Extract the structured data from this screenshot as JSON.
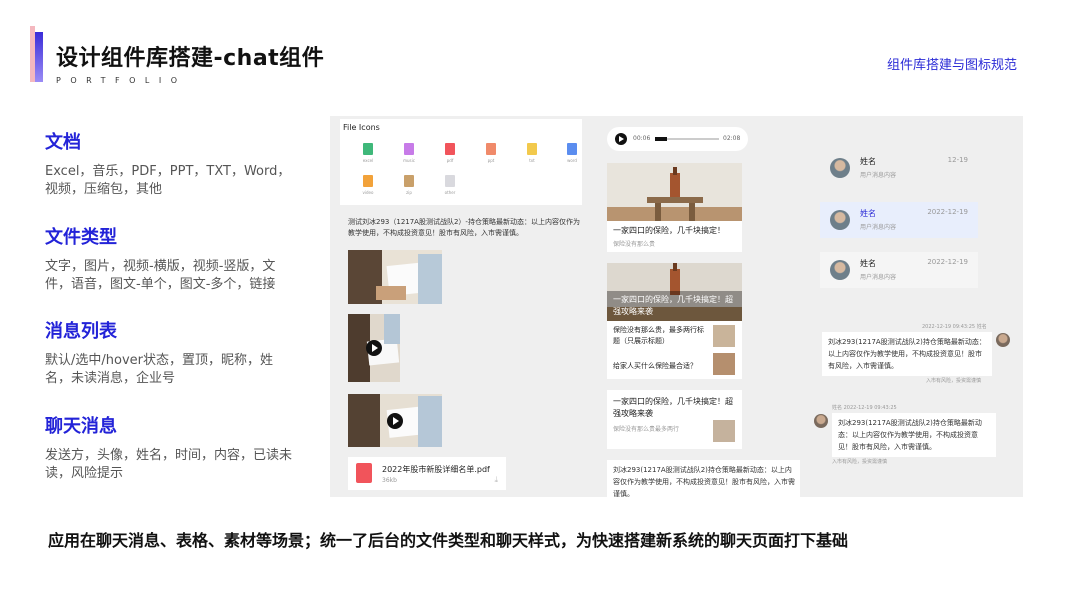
{
  "header": {
    "title": "设计组件库搭建-chat组件",
    "subtitle": "PORTFOLIO",
    "top_link": "组件库搭建与图标规范"
  },
  "sections": [
    {
      "heading": "文档",
      "body": "Excel，音乐，PDF，PPT，TXT，Word，视频，压缩包，其他"
    },
    {
      "heading": "文件类型",
      "body": "文字，图片，视频-横版，视频-竖版，文件，语音，图文-单个，图文-多个，链接"
    },
    {
      "heading": "消息列表",
      "body": "默认/选中/hover状态，置顶，昵称，姓名，未读消息，企业号"
    },
    {
      "heading": "聊天消息",
      "body": "发送方，头像，姓名，时间，内容，已读未读，风险提示"
    }
  ],
  "bottom_summary": "应用在聊天消息、表格、素材等场景；统一了后台的文件类型和聊天样式，为快速搭建新系统的聊天页面打下基础",
  "panel": {
    "file_icons": {
      "title": "File Icons",
      "items": [
        {
          "label": "excel",
          "color": "#3fb87a"
        },
        {
          "label": "music",
          "color": "#c77be8"
        },
        {
          "label": "pdf",
          "color": "#f1545b"
        },
        {
          "label": "ppt",
          "color": "#f08a6a"
        },
        {
          "label": "txt",
          "color": "#f2c94c"
        },
        {
          "label": "word",
          "color": "#5b8def"
        },
        {
          "label": "video",
          "color": "#f2a23a"
        },
        {
          "label": "zip",
          "color": "#c9a06a"
        },
        {
          "label": "other",
          "color": "#d9d9de"
        }
      ]
    },
    "text_message": "测试刘冰293（1217A股测试战队2）-持仓策略最新动态：以上内容仅作为教学使用，不构成投资意见！股市有风险，入市需谨慎。",
    "pdf_file": {
      "name": "2022年股市新股详细名单.pdf",
      "size": "36kb",
      "download_icon": "download-icon"
    },
    "audio": {
      "start": "00:06",
      "end": "02:08"
    },
    "article_single": {
      "title": "一家四口的保险，几千块搞定！",
      "meta": "保险没有那么贵"
    },
    "article_multi": {
      "cover_title": "一家四口的保险，几千块搞定！超强攻略来袭",
      "items": [
        "保险没有那么贵，最多两行标题（只展示标题）",
        "给家人买什么保险最合适？"
      ]
    },
    "article_link": {
      "title": "一家四口的保险，几千块搞定！超强攻略来袭",
      "meta": "保险没有那么贵最多两行"
    },
    "text_message_2": "刘冰293(1217A股测试战队2)持仓策略最新动态：以上内容仅作为教学使用，不构成投资意见！股市有风险，入市需谨慎。",
    "conversations": [
      {
        "name": "姓名",
        "time": "12-19",
        "preview": "用户消息内容",
        "selected": false
      },
      {
        "name": "姓名",
        "time": "2022-12-19",
        "preview": "用户消息内容",
        "selected": true
      },
      {
        "name": "姓名",
        "time": "2022-12-19",
        "preview": "用户消息内容",
        "selected": false
      }
    ],
    "chat_right": {
      "meta": "2022-12-19 09:43:25  姓名",
      "text": "刘冰293(1217A股测试战队2)持仓策略最新动态：以上内容仅作为教学使用，不构成投资意见！股市有风险，入市需谨慎。",
      "risk": "入市有风险，投资需谨慎"
    },
    "chat_left": {
      "meta": "姓名 2022-12-19 09:43:25",
      "text": "刘冰293(1217A股测试战队2)持仓策略最新动态：以上内容仅作为教学使用，不构成投资意见！股市有风险，入市需谨慎。",
      "risk": "入市有风险，投资需谨慎"
    }
  }
}
